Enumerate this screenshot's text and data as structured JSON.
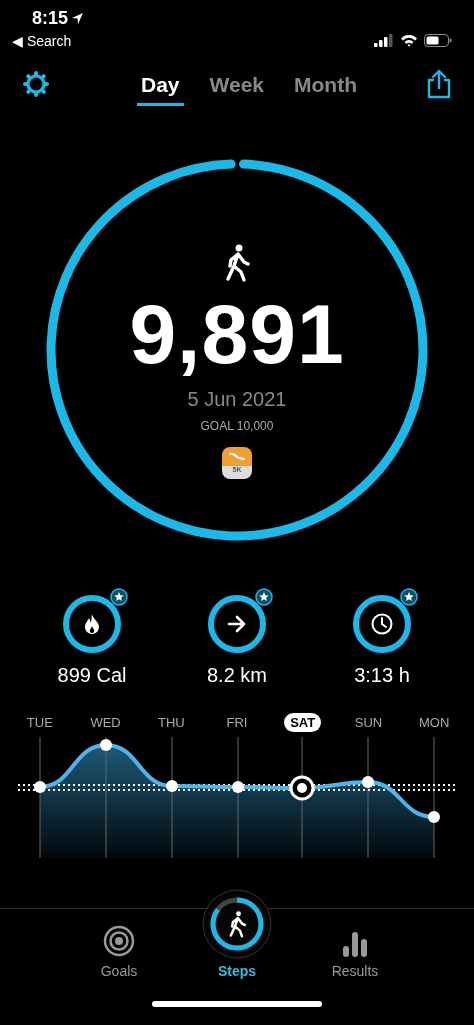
{
  "status_bar": {
    "time": "8:15",
    "back_label": "◀ Search"
  },
  "header": {
    "tabs": [
      {
        "label": "Day",
        "selected": true
      },
      {
        "label": "Week",
        "selected": false
      },
      {
        "label": "Month",
        "selected": false
      }
    ]
  },
  "summary": {
    "level": 0.989,
    "steps": "9,891",
    "date": "5 Jun 2021",
    "goal": "GOAL 10,000",
    "badge": "5K"
  },
  "stats": [
    {
      "kind": "calories",
      "value": "899 Cal"
    },
    {
      "kind": "distance",
      "value": "8.2 km"
    },
    {
      "kind": "duration",
      "value": "3:13 h"
    }
  ],
  "week": {
    "days": [
      {
        "label": "TUE",
        "selected": false
      },
      {
        "label": "WED",
        "selected": false
      },
      {
        "label": "THU",
        "selected": false
      },
      {
        "label": "FRI",
        "selected": false
      },
      {
        "label": "SAT",
        "selected": true
      },
      {
        "label": "SUN",
        "selected": false
      },
      {
        "label": "MON",
        "selected": false
      }
    ]
  },
  "tab_bar": {
    "items": [
      {
        "kind": "goals",
        "label": "Goals",
        "selected": false
      },
      {
        "kind": "steps",
        "label": "Steps",
        "selected": true
      },
      {
        "kind": "results",
        "label": "Results",
        "selected": false
      }
    ]
  }
}
